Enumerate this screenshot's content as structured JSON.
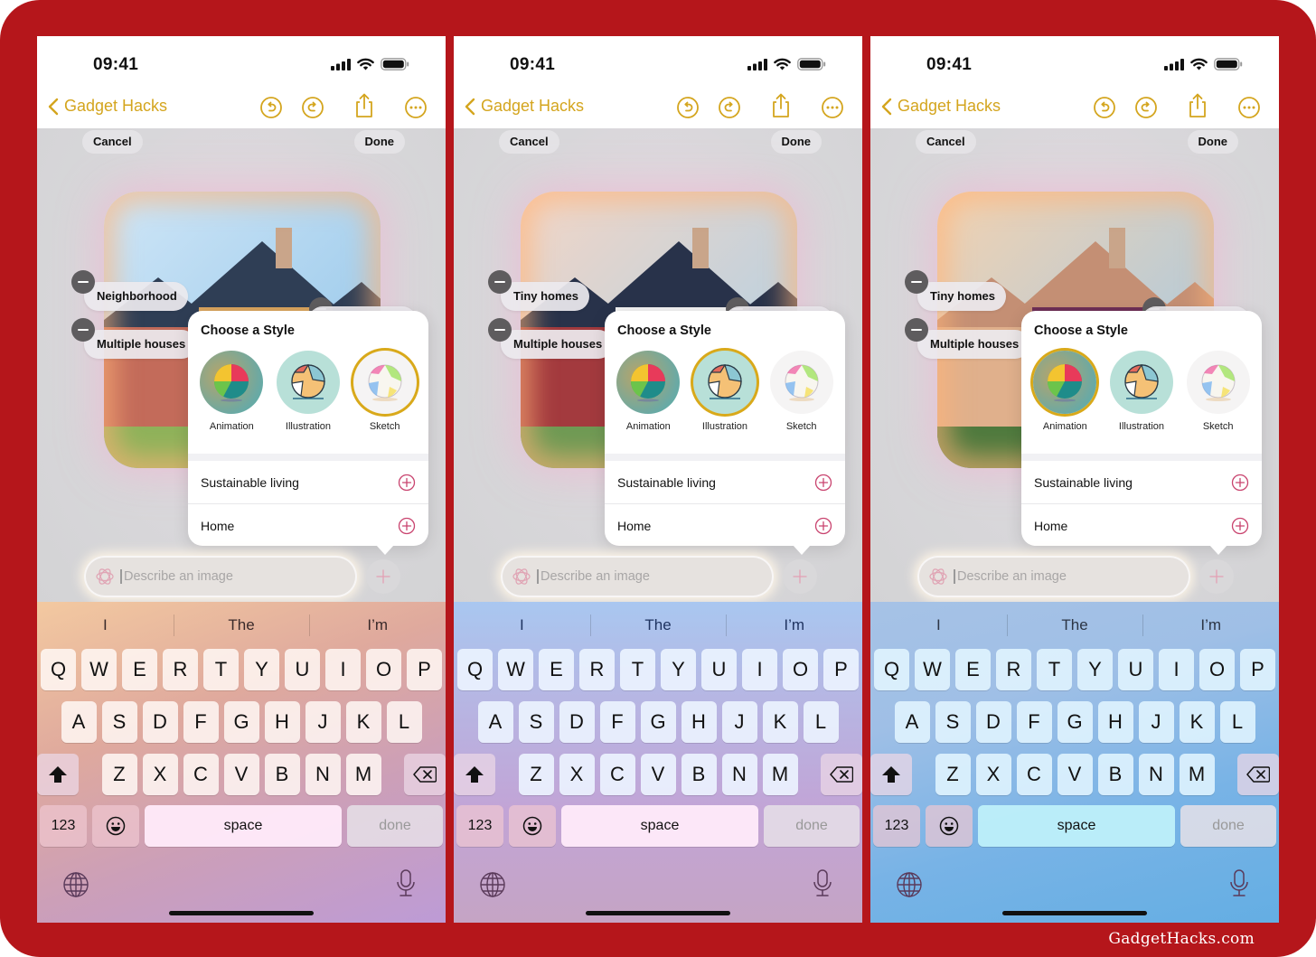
{
  "watermark": "GadgetHacks.com",
  "colors": {
    "frame": "#b5161b",
    "accent": "#d4a51e",
    "selected_ring": "#d9a91a",
    "plus_icon": "#c9446f"
  },
  "screens": [
    {
      "time": "09:41",
      "back_label": "Gadget Hacks",
      "cancel_label": "Cancel",
      "done_label": "Done",
      "tags": [
        "Neighborhood",
        "Multiple houses"
      ],
      "image_alt": "Sketch-style house illustration",
      "popup_title": "Choose a Style",
      "styles": [
        {
          "label": "Animation",
          "selected": false
        },
        {
          "label": "Illustration",
          "selected": false
        },
        {
          "label": "Sketch",
          "selected": true
        }
      ],
      "suggestions": [
        {
          "label": "Sustainable living",
          "icon": "plus-circle-icon"
        },
        {
          "label": "Home",
          "icon": "plus-circle-icon"
        }
      ],
      "prompt_placeholder": "Describe an image",
      "keyboard": {
        "predictions": [
          "I",
          "The",
          "I’m"
        ],
        "row1": [
          "Q",
          "W",
          "E",
          "R",
          "T",
          "Y",
          "U",
          "I",
          "O",
          "P"
        ],
        "row2": [
          "A",
          "S",
          "D",
          "F",
          "G",
          "H",
          "J",
          "K",
          "L"
        ],
        "row3": [
          "Z",
          "X",
          "C",
          "V",
          "B",
          "N",
          "M"
        ],
        "num_label": "123",
        "space_label": "space",
        "done_label": "done"
      }
    },
    {
      "time": "09:41",
      "back_label": "Gadget Hacks",
      "cancel_label": "Cancel",
      "done_label": "Done",
      "tags": [
        "Tiny homes",
        "Multiple houses"
      ],
      "image_alt": "Illustration-style tiny homes",
      "popup_title": "Choose a Style",
      "styles": [
        {
          "label": "Animation",
          "selected": false
        },
        {
          "label": "Illustration",
          "selected": true
        },
        {
          "label": "Sketch",
          "selected": false
        }
      ],
      "suggestions": [
        {
          "label": "Sustainable living",
          "icon": "plus-circle-icon"
        },
        {
          "label": "Home",
          "icon": "plus-circle-icon"
        }
      ],
      "prompt_placeholder": "Describe an image",
      "keyboard": {
        "predictions": [
          "I",
          "The",
          "I’m"
        ],
        "row1": [
          "Q",
          "W",
          "E",
          "R",
          "T",
          "Y",
          "U",
          "I",
          "O",
          "P"
        ],
        "row2": [
          "A",
          "S",
          "D",
          "F",
          "G",
          "H",
          "J",
          "K",
          "L"
        ],
        "row3": [
          "Z",
          "X",
          "C",
          "V",
          "B",
          "N",
          "M"
        ],
        "num_label": "123",
        "space_label": "space",
        "done_label": "done"
      }
    },
    {
      "time": "09:41",
      "back_label": "Gadget Hacks",
      "cancel_label": "Cancel",
      "done_label": "Done",
      "tags": [
        "Tiny homes",
        "Multiple houses"
      ],
      "image_alt": "Animation-style tiny homes",
      "popup_title": "Choose a Style",
      "styles": [
        {
          "label": "Animation",
          "selected": true
        },
        {
          "label": "Illustration",
          "selected": false
        },
        {
          "label": "Sketch",
          "selected": false
        }
      ],
      "suggestions": [
        {
          "label": "Sustainable living",
          "icon": "plus-circle-icon"
        },
        {
          "label": "Home",
          "icon": "plus-circle-icon"
        }
      ],
      "prompt_placeholder": "Describe an image",
      "keyboard": {
        "predictions": [
          "I",
          "The",
          "I’m"
        ],
        "row1": [
          "Q",
          "W",
          "E",
          "R",
          "T",
          "Y",
          "U",
          "I",
          "O",
          "P"
        ],
        "row2": [
          "A",
          "S",
          "D",
          "F",
          "G",
          "H",
          "J",
          "K",
          "L"
        ],
        "row3": [
          "Z",
          "X",
          "C",
          "V",
          "B",
          "N",
          "M"
        ],
        "num_label": "123",
        "space_label": "space",
        "done_label": "done"
      }
    }
  ]
}
